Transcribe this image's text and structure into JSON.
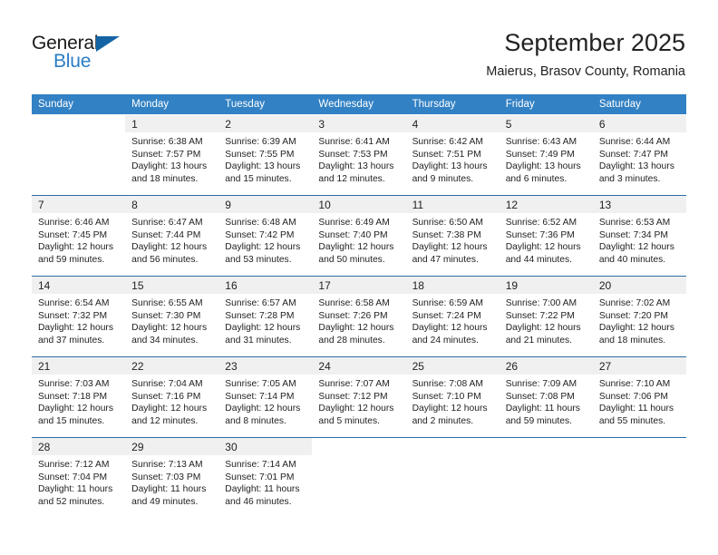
{
  "branding": {
    "name_primary": "General",
    "name_secondary": "Blue",
    "triangle_icon": "triangle-icon"
  },
  "header": {
    "title": "September 2025",
    "subtitle": "Maierus, Brasov County, Romania"
  },
  "colors": {
    "header_blue": "#3281c4",
    "separator_blue": "#2e6da4",
    "daynum_gray": "#f0f0f0",
    "logo_blue": "#2b7cc4",
    "logo_triangle": "#1464a5",
    "text": "#222222"
  },
  "weekday_headers": [
    "Sunday",
    "Monday",
    "Tuesday",
    "Wednesday",
    "Thursday",
    "Friday",
    "Saturday"
  ],
  "weeks": [
    [
      {
        "day": "",
        "sunrise": "",
        "sunset": "",
        "daylight": ""
      },
      {
        "day": "1",
        "sunrise": "Sunrise: 6:38 AM",
        "sunset": "Sunset: 7:57 PM",
        "daylight": "Daylight: 13 hours and 18 minutes."
      },
      {
        "day": "2",
        "sunrise": "Sunrise: 6:39 AM",
        "sunset": "Sunset: 7:55 PM",
        "daylight": "Daylight: 13 hours and 15 minutes."
      },
      {
        "day": "3",
        "sunrise": "Sunrise: 6:41 AM",
        "sunset": "Sunset: 7:53 PM",
        "daylight": "Daylight: 13 hours and 12 minutes."
      },
      {
        "day": "4",
        "sunrise": "Sunrise: 6:42 AM",
        "sunset": "Sunset: 7:51 PM",
        "daylight": "Daylight: 13 hours and 9 minutes."
      },
      {
        "day": "5",
        "sunrise": "Sunrise: 6:43 AM",
        "sunset": "Sunset: 7:49 PM",
        "daylight": "Daylight: 13 hours and 6 minutes."
      },
      {
        "day": "6",
        "sunrise": "Sunrise: 6:44 AM",
        "sunset": "Sunset: 7:47 PM",
        "daylight": "Daylight: 13 hours and 3 minutes."
      }
    ],
    [
      {
        "day": "7",
        "sunrise": "Sunrise: 6:46 AM",
        "sunset": "Sunset: 7:45 PM",
        "daylight": "Daylight: 12 hours and 59 minutes."
      },
      {
        "day": "8",
        "sunrise": "Sunrise: 6:47 AM",
        "sunset": "Sunset: 7:44 PM",
        "daylight": "Daylight: 12 hours and 56 minutes."
      },
      {
        "day": "9",
        "sunrise": "Sunrise: 6:48 AM",
        "sunset": "Sunset: 7:42 PM",
        "daylight": "Daylight: 12 hours and 53 minutes."
      },
      {
        "day": "10",
        "sunrise": "Sunrise: 6:49 AM",
        "sunset": "Sunset: 7:40 PM",
        "daylight": "Daylight: 12 hours and 50 minutes."
      },
      {
        "day": "11",
        "sunrise": "Sunrise: 6:50 AM",
        "sunset": "Sunset: 7:38 PM",
        "daylight": "Daylight: 12 hours and 47 minutes."
      },
      {
        "day": "12",
        "sunrise": "Sunrise: 6:52 AM",
        "sunset": "Sunset: 7:36 PM",
        "daylight": "Daylight: 12 hours and 44 minutes."
      },
      {
        "day": "13",
        "sunrise": "Sunrise: 6:53 AM",
        "sunset": "Sunset: 7:34 PM",
        "daylight": "Daylight: 12 hours and 40 minutes."
      }
    ],
    [
      {
        "day": "14",
        "sunrise": "Sunrise: 6:54 AM",
        "sunset": "Sunset: 7:32 PM",
        "daylight": "Daylight: 12 hours and 37 minutes."
      },
      {
        "day": "15",
        "sunrise": "Sunrise: 6:55 AM",
        "sunset": "Sunset: 7:30 PM",
        "daylight": "Daylight: 12 hours and 34 minutes."
      },
      {
        "day": "16",
        "sunrise": "Sunrise: 6:57 AM",
        "sunset": "Sunset: 7:28 PM",
        "daylight": "Daylight: 12 hours and 31 minutes."
      },
      {
        "day": "17",
        "sunrise": "Sunrise: 6:58 AM",
        "sunset": "Sunset: 7:26 PM",
        "daylight": "Daylight: 12 hours and 28 minutes."
      },
      {
        "day": "18",
        "sunrise": "Sunrise: 6:59 AM",
        "sunset": "Sunset: 7:24 PM",
        "daylight": "Daylight: 12 hours and 24 minutes."
      },
      {
        "day": "19",
        "sunrise": "Sunrise: 7:00 AM",
        "sunset": "Sunset: 7:22 PM",
        "daylight": "Daylight: 12 hours and 21 minutes."
      },
      {
        "day": "20",
        "sunrise": "Sunrise: 7:02 AM",
        "sunset": "Sunset: 7:20 PM",
        "daylight": "Daylight: 12 hours and 18 minutes."
      }
    ],
    [
      {
        "day": "21",
        "sunrise": "Sunrise: 7:03 AM",
        "sunset": "Sunset: 7:18 PM",
        "daylight": "Daylight: 12 hours and 15 minutes."
      },
      {
        "day": "22",
        "sunrise": "Sunrise: 7:04 AM",
        "sunset": "Sunset: 7:16 PM",
        "daylight": "Daylight: 12 hours and 12 minutes."
      },
      {
        "day": "23",
        "sunrise": "Sunrise: 7:05 AM",
        "sunset": "Sunset: 7:14 PM",
        "daylight": "Daylight: 12 hours and 8 minutes."
      },
      {
        "day": "24",
        "sunrise": "Sunrise: 7:07 AM",
        "sunset": "Sunset: 7:12 PM",
        "daylight": "Daylight: 12 hours and 5 minutes."
      },
      {
        "day": "25",
        "sunrise": "Sunrise: 7:08 AM",
        "sunset": "Sunset: 7:10 PM",
        "daylight": "Daylight: 12 hours and 2 minutes."
      },
      {
        "day": "26",
        "sunrise": "Sunrise: 7:09 AM",
        "sunset": "Sunset: 7:08 PM",
        "daylight": "Daylight: 11 hours and 59 minutes."
      },
      {
        "day": "27",
        "sunrise": "Sunrise: 7:10 AM",
        "sunset": "Sunset: 7:06 PM",
        "daylight": "Daylight: 11 hours and 55 minutes."
      }
    ],
    [
      {
        "day": "28",
        "sunrise": "Sunrise: 7:12 AM",
        "sunset": "Sunset: 7:04 PM",
        "daylight": "Daylight: 11 hours and 52 minutes."
      },
      {
        "day": "29",
        "sunrise": "Sunrise: 7:13 AM",
        "sunset": "Sunset: 7:03 PM",
        "daylight": "Daylight: 11 hours and 49 minutes."
      },
      {
        "day": "30",
        "sunrise": "Sunrise: 7:14 AM",
        "sunset": "Sunset: 7:01 PM",
        "daylight": "Daylight: 11 hours and 46 minutes."
      },
      {
        "day": "",
        "sunrise": "",
        "sunset": "",
        "daylight": ""
      },
      {
        "day": "",
        "sunrise": "",
        "sunset": "",
        "daylight": ""
      },
      {
        "day": "",
        "sunrise": "",
        "sunset": "",
        "daylight": ""
      },
      {
        "day": "",
        "sunrise": "",
        "sunset": "",
        "daylight": ""
      }
    ]
  ]
}
